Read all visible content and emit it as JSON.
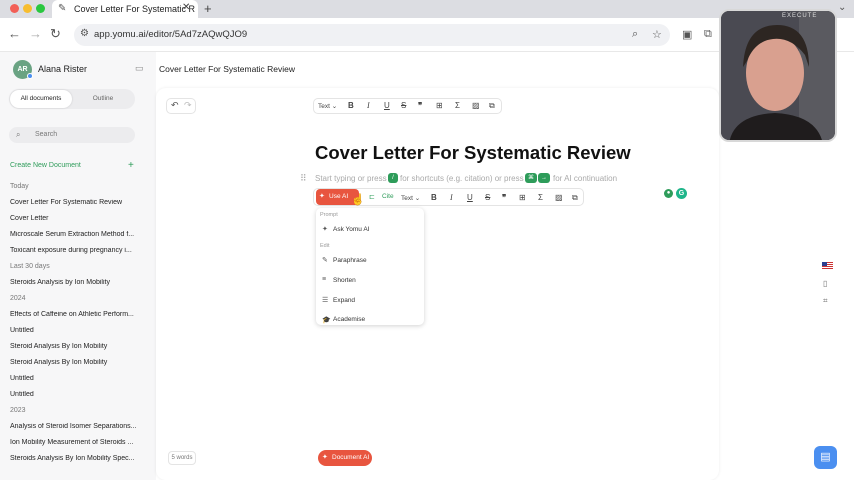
{
  "browser": {
    "tab_title": "Cover Letter For Systematic R",
    "tab_close": "✕",
    "new_tab": "+",
    "url": "app.yomu.ai/editor/5Ad7zAQwQJO9",
    "back": "←",
    "forward": "→",
    "reload": "↻"
  },
  "sidebar": {
    "avatar_initials": "AR",
    "user_name": "Alana Rister",
    "tabs": [
      "All documents",
      "Outline"
    ],
    "search_placeholder": "Search",
    "create_label": "Create New Document",
    "create_plus": "+",
    "groups": [
      {
        "label": "Today",
        "docs": [
          "Cover Letter For Systematic Review",
          "Cover Letter",
          "Microscale Serum Extraction Method f...",
          "Toxicant exposure during pregnancy i..."
        ]
      },
      {
        "label": "Last 30 days",
        "docs": [
          "Steroids Analysis by Ion Mobility"
        ]
      },
      {
        "label": "2024",
        "docs": [
          "Effects of Caffeine on Athletic Perform...",
          "Untitled",
          "Steroid Analysis By Ion Mobility",
          "Steroid Analysis By Ion Mobility",
          "Untitled",
          "Untitled"
        ]
      },
      {
        "label": "2023",
        "docs": [
          "Analysis of Steroid Isomer Separations...",
          "Ion Mobility Measurement of Steroids ...",
          "Steroids Analysis By Ion Mobility Spec..."
        ]
      }
    ]
  },
  "editor": {
    "header_title": "Cover Letter For Systematic Review",
    "toolbar_text_style": "Text",
    "heading": "Cover Letter For Systematic Review",
    "placeholder_a": "Start typing or press",
    "key_slash": "/",
    "placeholder_b": "for shortcuts (e.g. citation) or press",
    "key_ctrl": "⌘",
    "key_arrow": "→",
    "placeholder_c": "for AI continuation",
    "use_ai_label": "Use AI",
    "cite_label": "Cite",
    "bubble_text_style": "Text",
    "word_count": "5 words",
    "document_ai_label": "Document AI"
  },
  "ai_menu": {
    "section_prompt": "Prompt",
    "ask": "Ask Yomu AI",
    "section_edit": "Edit",
    "items": [
      "Paraphrase",
      "Shorten",
      "Expand",
      "Academise"
    ]
  },
  "webcam": {
    "label": "EXECUTE"
  },
  "colors": {
    "accent_orange": "#e8553f",
    "accent_green": "#2e9c5a",
    "help_blue": "#4b8ff0"
  }
}
